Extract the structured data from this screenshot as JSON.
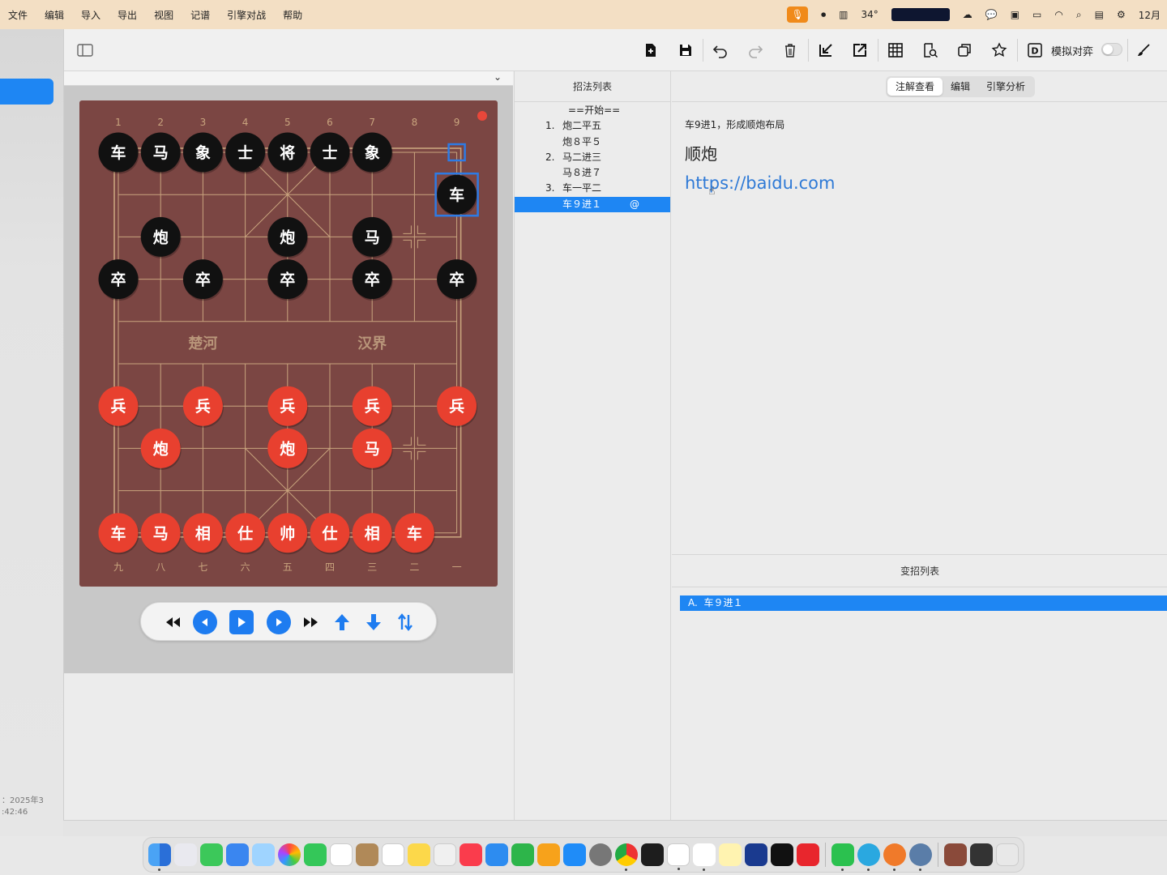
{
  "menubar": {
    "items": [
      "文件",
      "编辑",
      "导入",
      "导出",
      "视图",
      "记谱",
      "引擎对战",
      "帮助"
    ],
    "temperature": "34°",
    "time": "12月"
  },
  "sidebar": {
    "date_line1": "：2025年3",
    "date_line2": ":42:46"
  },
  "toolbar": {
    "sim_label": "模拟对弈"
  },
  "board": {
    "colors": {
      "board_bg": "#7b4643",
      "line": "#c9a47e",
      "black_piece": "#111111",
      "red_piece": "#e8402f",
      "highlight": "#2d7be5"
    },
    "top_files": [
      "1",
      "2",
      "3",
      "4",
      "5",
      "6",
      "7",
      "8",
      "9"
    ],
    "bottom_files": [
      "九",
      "八",
      "七",
      "六",
      "五",
      "四",
      "三",
      "二",
      "一"
    ],
    "river_left": "楚河",
    "river_right": "汉界",
    "black_pieces": [
      {
        "ch": "车",
        "file": 0,
        "rank": 0
      },
      {
        "ch": "马",
        "file": 1,
        "rank": 0
      },
      {
        "ch": "象",
        "file": 2,
        "rank": 0
      },
      {
        "ch": "士",
        "file": 3,
        "rank": 0
      },
      {
        "ch": "将",
        "file": 4,
        "rank": 0
      },
      {
        "ch": "士",
        "file": 5,
        "rank": 0
      },
      {
        "ch": "象",
        "file": 6,
        "rank": 0
      },
      {
        "ch": "车",
        "file": 8,
        "rank": 1
      },
      {
        "ch": "炮",
        "file": 1,
        "rank": 2
      },
      {
        "ch": "炮",
        "file": 4,
        "rank": 2
      },
      {
        "ch": "马",
        "file": 6,
        "rank": 2
      },
      {
        "ch": "卒",
        "file": 0,
        "rank": 3
      },
      {
        "ch": "卒",
        "file": 2,
        "rank": 3
      },
      {
        "ch": "卒",
        "file": 4,
        "rank": 3
      },
      {
        "ch": "卒",
        "file": 6,
        "rank": 3
      },
      {
        "ch": "卒",
        "file": 8,
        "rank": 3
      }
    ],
    "red_pieces": [
      {
        "ch": "兵",
        "file": 0,
        "rank": 6
      },
      {
        "ch": "兵",
        "file": 2,
        "rank": 6
      },
      {
        "ch": "兵",
        "file": 4,
        "rank": 6
      },
      {
        "ch": "兵",
        "file": 6,
        "rank": 6
      },
      {
        "ch": "兵",
        "file": 8,
        "rank": 6
      },
      {
        "ch": "炮",
        "file": 1,
        "rank": 7
      },
      {
        "ch": "炮",
        "file": 4,
        "rank": 7
      },
      {
        "ch": "马",
        "file": 6,
        "rank": 7
      },
      {
        "ch": "车",
        "file": 0,
        "rank": 9
      },
      {
        "ch": "马",
        "file": 1,
        "rank": 9
      },
      {
        "ch": "相",
        "file": 2,
        "rank": 9
      },
      {
        "ch": "仕",
        "file": 3,
        "rank": 9
      },
      {
        "ch": "帅",
        "file": 4,
        "rank": 9
      },
      {
        "ch": "仕",
        "file": 5,
        "rank": 9
      },
      {
        "ch": "相",
        "file": 6,
        "rank": 9
      },
      {
        "ch": "车",
        "file": 7,
        "rank": 9
      }
    ],
    "last_move_from": {
      "file": 8,
      "rank": 0
    },
    "last_move_to": {
      "file": 8,
      "rank": 1
    }
  },
  "moves": {
    "header": "招法列表",
    "start": "==开始==",
    "list": [
      {
        "num": "1.",
        "text": "炮二平五",
        "selected": false
      },
      {
        "num": "",
        "text": "炮８平５",
        "selected": false
      },
      {
        "num": "2.",
        "text": "马二进三",
        "selected": false
      },
      {
        "num": "",
        "text": "马８进７",
        "selected": false
      },
      {
        "num": "3.",
        "text": "车一平二",
        "selected": false
      },
      {
        "num": "",
        "text": "车９进１",
        "selected": true,
        "mark": "@"
      }
    ]
  },
  "notes": {
    "tabs": [
      "注解查看",
      "编辑",
      "引擎分析"
    ],
    "active_tab": 0,
    "comment": "车9进1，形成顺炮布局",
    "title": "顺炮",
    "link": "https://baidu.com"
  },
  "variations": {
    "header": "变招列表",
    "items": [
      "A.  车９进１"
    ]
  }
}
